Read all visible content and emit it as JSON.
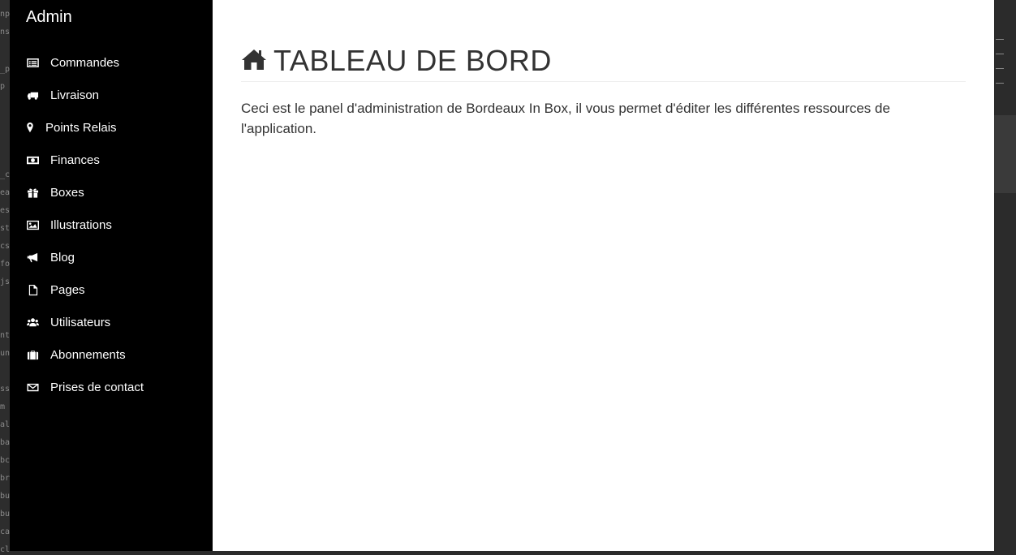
{
  "sidebar": {
    "brand": "Admin",
    "items": [
      {
        "label": "Commandes",
        "icon": "list-alt-icon"
      },
      {
        "label": "Livraison",
        "icon": "truck-icon"
      },
      {
        "label": "Points Relais",
        "icon": "map-marker-icon"
      },
      {
        "label": "Finances",
        "icon": "money-icon"
      },
      {
        "label": "Boxes",
        "icon": "gift-icon"
      },
      {
        "label": "Illustrations",
        "icon": "picture-icon"
      },
      {
        "label": "Blog",
        "icon": "bullhorn-icon"
      },
      {
        "label": "Pages",
        "icon": "file-icon"
      },
      {
        "label": "Utilisateurs",
        "icon": "users-icon"
      },
      {
        "label": "Abonnements",
        "icon": "suitcase-icon"
      },
      {
        "label": "Prises de contact",
        "icon": "envelope-icon"
      }
    ]
  },
  "main": {
    "title": "TABLEAU DE BORD",
    "title_icon": "home-icon",
    "intro": "Ceci est le panel d'administration de Bordeaux In Box, il vous permet d'éditer les différentes ressources de l'application."
  },
  "background_editor_fragments": [
    "np",
    "ns.",
    "_pl",
    "p",
    "_cc",
    "ear",
    "est",
    "st",
    "cs",
    "fo",
    "js",
    "nt",
    "un",
    "ss",
    "m",
    "al",
    "ba",
    "bc",
    "br",
    "bu",
    "bu",
    "ca",
    "cl"
  ],
  "colors": {
    "sidebar_bg": "#000000",
    "main_bg": "#ffffff",
    "text": "#333333",
    "sidebar_text": "#ffffff"
  }
}
